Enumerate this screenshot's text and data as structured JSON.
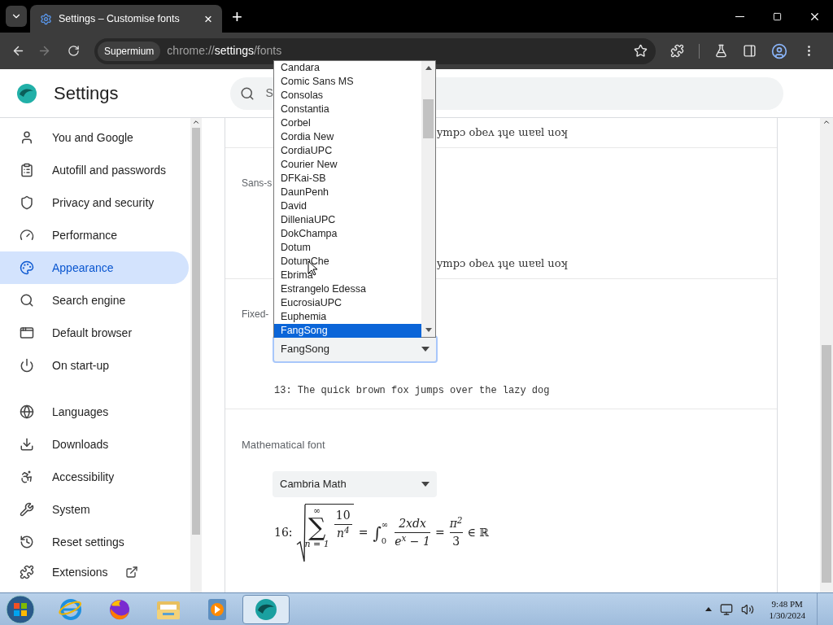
{
  "browser": {
    "tab_title": "Settings – Customise fonts",
    "tab_close": "×",
    "new_tab": "+",
    "forward_disabled": true,
    "omnibox": {
      "chip": "Supermium",
      "url_scheme": "chrome://",
      "url_host": "settings",
      "url_path": "/fonts"
    }
  },
  "header": {
    "title": "Settings",
    "search_placeholder": "S"
  },
  "sidebar": {
    "groups": [
      [
        {
          "label": "You and Google",
          "selected": false
        },
        {
          "label": "Autofill and passwords",
          "selected": false
        },
        {
          "label": "Privacy and security",
          "selected": false
        },
        {
          "label": "Performance",
          "selected": false
        },
        {
          "label": "Appearance",
          "selected": true
        },
        {
          "label": "Search engine",
          "selected": false
        },
        {
          "label": "Default browser",
          "selected": false
        },
        {
          "label": "On start-up",
          "selected": false
        }
      ],
      [
        {
          "label": "Languages",
          "selected": false
        },
        {
          "label": "Downloads",
          "selected": false
        },
        {
          "label": "Accessibility",
          "selected": false
        },
        {
          "label": "System",
          "selected": false
        },
        {
          "label": "Reset settings",
          "selected": false
        }
      ],
      [
        {
          "label": "Extensions",
          "selected": false
        }
      ]
    ]
  },
  "content": {
    "top_sample": "ympɔ obeʌ ʇɥe ɯɐɐl uoʞ",
    "sans_serif": {
      "label": "Sans-s",
      "sample": "ympɔ obeʌ ʇɥe ɯɐɐl uoʞ"
    },
    "fixed_width": {
      "label": "Fixed-",
      "select_value": "FangSong",
      "sample": "13: The quick brown fox jumps over the lazy dog"
    },
    "math": {
      "label": "Mathematical font",
      "select_value": "Cambria Math",
      "prefix": "16:",
      "sum_upper": "∞",
      "sum_symbol": "∑",
      "sum_lower": "n = 1",
      "frac1_num": "10",
      "frac1_den": "n$^{4}$",
      "eq1": "=",
      "integral": "∫",
      "int_upper": "∞",
      "int_lower": "0",
      "frac2_num": "2xdx",
      "frac2_den": "e$^{x}$ − 1",
      "eq2": "=",
      "frac3_num": "π$^{2}$",
      "frac3_den": "3",
      "tail": "∈ ℝ"
    }
  },
  "dropdown": {
    "options": [
      {
        "label": "Candara",
        "selected": false
      },
      {
        "label": "Comic Sans MS",
        "selected": false
      },
      {
        "label": "Consolas",
        "selected": false
      },
      {
        "label": "Constantia",
        "selected": false
      },
      {
        "label": "Corbel",
        "selected": false
      },
      {
        "label": "Cordia New",
        "selected": false
      },
      {
        "label": "CordiaUPC",
        "selected": false
      },
      {
        "label": "Courier New",
        "selected": false
      },
      {
        "label": "DFKai-SB",
        "selected": false
      },
      {
        "label": "DaunPenh",
        "selected": false
      },
      {
        "label": "David",
        "selected": false
      },
      {
        "label": "DilleniaUPC",
        "selected": false
      },
      {
        "label": "DokChampa",
        "selected": false
      },
      {
        "label": "Dotum",
        "selected": false
      },
      {
        "label": "DotumChe",
        "selected": false
      },
      {
        "label": "Ebrima",
        "selected": false
      },
      {
        "label": "Estrangelo Edessa",
        "selected": false
      },
      {
        "label": "EucrosiaUPC",
        "selected": false
      },
      {
        "label": "Euphemia",
        "selected": false
      },
      {
        "label": "FangSong",
        "selected": true
      }
    ]
  },
  "taskbar": {
    "apps": [
      {
        "selected": false
      },
      {
        "selected": false
      },
      {
        "selected": false
      },
      {
        "selected": false
      },
      {
        "selected": true
      }
    ],
    "time": "9:48 PM",
    "date": "1/30/2024"
  }
}
